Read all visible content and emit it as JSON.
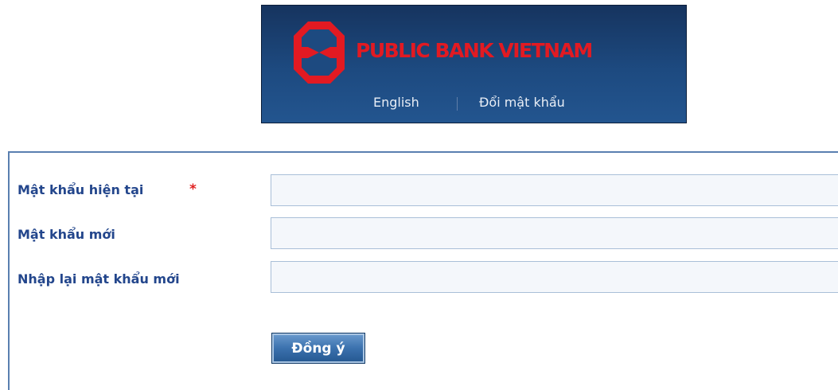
{
  "header": {
    "brand": "PUBLIC BANK VIETNAM",
    "links": {
      "english": "English",
      "change_password": "Đổi mật khẩu"
    },
    "colors": {
      "background": "#1d4a80",
      "brand_red": "#e21a22"
    }
  },
  "form": {
    "current_password": {
      "label": "Mật khẩu hiện tại",
      "required_mark": "*",
      "value": ""
    },
    "new_password": {
      "label": "Mật khẩu mới",
      "value": ""
    },
    "confirm_password": {
      "label": "Nhập lại mật khẩu mới",
      "value": ""
    },
    "submit_label": "Đồng ý",
    "label_color": "#23468c"
  }
}
